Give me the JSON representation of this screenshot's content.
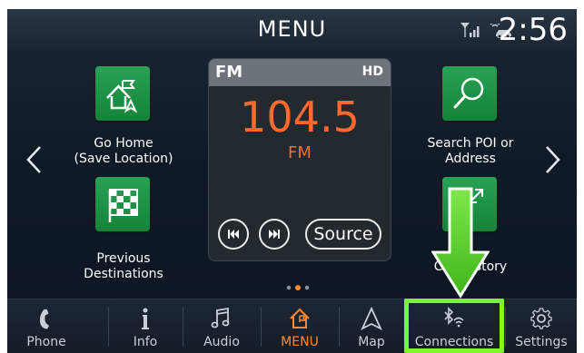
{
  "header": {
    "title": "MENU",
    "clock": "2:56",
    "icons": [
      "signal-icon",
      "car-connect-icon"
    ]
  },
  "tiles": {
    "go_home": {
      "label_line1": "Go Home",
      "label_line2": "(Save Location)",
      "icon": "home-flag-icon"
    },
    "previous_destinations": {
      "label_line1": "Previous",
      "label_line2": "Destinations",
      "icon": "checkered-flag-icon"
    },
    "search_poi": {
      "label_line1": "Search POI or",
      "label_line2": "Address",
      "icon": "magnifier-icon"
    },
    "call_history": {
      "label": "Call History",
      "icon": "phone-arrows-icon"
    }
  },
  "radio": {
    "band": "FM",
    "hd_label": "HD",
    "frequency": "104.5",
    "unit": "FM",
    "source_label": "Source"
  },
  "page_indicator": {
    "count": 3,
    "active_index": 1
  },
  "bottom_bar": {
    "items": [
      {
        "label": "Phone",
        "icon": "phone-icon"
      },
      {
        "label": "Info",
        "icon": "info-icon"
      },
      {
        "label": "Audio",
        "icon": "music-note-icon"
      },
      {
        "label": "MENU",
        "icon": "home-icon",
        "active": true
      },
      {
        "label": "Map",
        "icon": "navigation-arrow-icon"
      },
      {
        "label": "Connections",
        "icon": "bluetooth-wifi-icon"
      },
      {
        "label": "Settings",
        "icon": "gear-icon"
      }
    ]
  },
  "colors": {
    "tile_green": "#1f9448",
    "frequency_orange": "#ff6b2e",
    "active_orange": "#ff8a30",
    "highlight_green": "#7df62c"
  }
}
